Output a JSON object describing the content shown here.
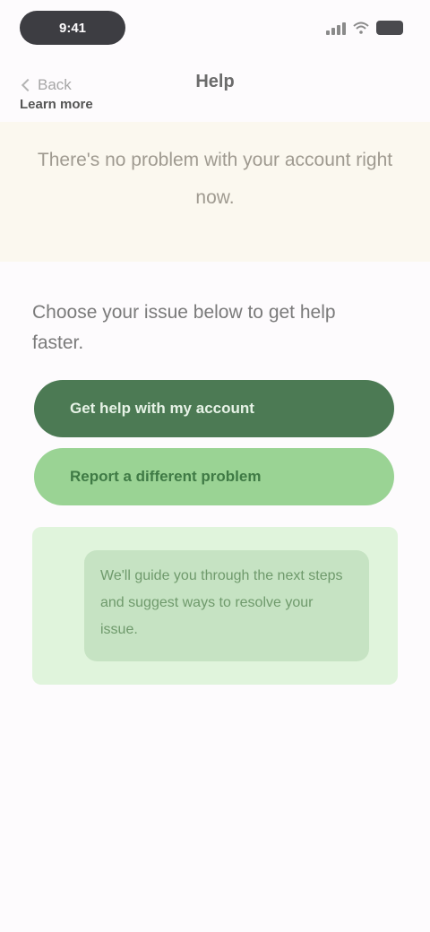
{
  "status_bar": {
    "time": "9:41",
    "icons": [
      "signal-icon",
      "wifi-icon",
      "battery-icon"
    ]
  },
  "nav": {
    "back_label": "Back",
    "title": "Help"
  },
  "notice": {
    "text": "There's no problem with your account right now.",
    "link_label": "Learn more"
  },
  "prompt": "Choose your issue below to get help faster.",
  "options": [
    {
      "label": "Get help with my account"
    },
    {
      "label": "Report a different problem"
    }
  ],
  "info_card": {
    "text": "We'll guide you through the next steps and suggest ways to resolve your issue."
  },
  "colors": {
    "primary_green": "#4c7a54",
    "secondary_green": "#9ad394",
    "card_green": "#e0f4dc",
    "notice_bg": "#fbf8ef"
  }
}
